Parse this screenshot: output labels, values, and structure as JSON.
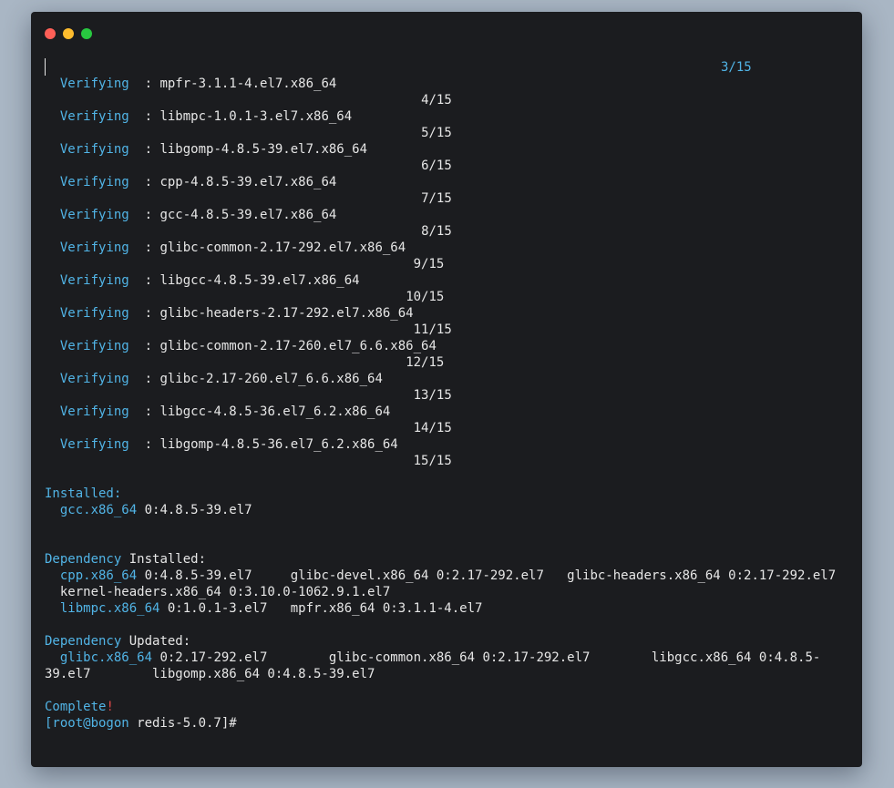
{
  "window": {
    "controls": {
      "close": "close",
      "minimize": "minimize",
      "maximize": "maximize"
    }
  },
  "terminal": {
    "top_counter": "3/15",
    "verify_lines": [
      {
        "label": "Verifying",
        "pkg": "mpfr-3.1.1-4.el7.x86_64",
        "count": "4/15"
      },
      {
        "label": "Verifying",
        "pkg": "libmpc-1.0.1-3.el7.x86_64",
        "count": "5/15"
      },
      {
        "label": "Verifying",
        "pkg": "libgomp-4.8.5-39.el7.x86_64",
        "count": "6/15"
      },
      {
        "label": "Verifying",
        "pkg": "cpp-4.8.5-39.el7.x86_64",
        "count": "7/15"
      },
      {
        "label": "Verifying",
        "pkg": "gcc-4.8.5-39.el7.x86_64",
        "count": "8/15"
      },
      {
        "label": "Verifying",
        "pkg": "glibc-common-2.17-292.el7.x86_64",
        "count": "9/15"
      },
      {
        "label": "Verifying",
        "pkg": "libgcc-4.8.5-39.el7.x86_64",
        "count": "10/15"
      },
      {
        "label": "Verifying",
        "pkg": "glibc-headers-2.17-292.el7.x86_64",
        "count": "11/15"
      },
      {
        "label": "Verifying",
        "pkg": "glibc-common-2.17-260.el7_6.6.x86_64",
        "count": "12/15"
      },
      {
        "label": "Verifying",
        "pkg": "glibc-2.17-260.el7_6.6.x86_64",
        "count": "13/15"
      },
      {
        "label": "Verifying",
        "pkg": "libgcc-4.8.5-36.el7_6.2.x86_64",
        "count": "14/15"
      },
      {
        "label": "Verifying",
        "pkg": "libgomp-4.8.5-36.el7_6.2.x86_64",
        "count": "15/15"
      }
    ],
    "installed": {
      "header": "Installed:",
      "pkg": "gcc.x86_64",
      "ver": " 0:4.8.5-39.el7"
    },
    "dep_installed": {
      "header_kw": "Dependency",
      "header_rest": " Installed:",
      "line1_pkg": "cpp.x86_64",
      "line1_rest": " 0:4.8.5-39.el7     glibc-devel.x86_64 0:2.17-292.el7   glibc-headers.x86_64 0:2.17-292.el7",
      "line2": "  kernel-headers.x86_64 0:3.10.0-1062.9.1.el7",
      "line3_pkg": "libmpc.x86_64",
      "line3_rest": " 0:1.0.1-3.el7   mpfr.x86_64 0:3.1.1-4.el7"
    },
    "dep_updated": {
      "header_kw": "Dependency",
      "header_rest": " Updated:",
      "line1_pkg": "glibc.x86_64",
      "line1_rest": " 0:2.17-292.el7        glibc-common.x86_64 0:2.17-292.el7        libgcc.x86_64 0:4.8.5-",
      "line2": "39.el7        libgomp.x86_64 0:4.8.5-39.el7"
    },
    "complete": {
      "word": "Complete",
      "bang": "!"
    },
    "prompt": {
      "bracket": "[root@bogon",
      "rest": " redis-5.0.7]#"
    }
  },
  "colors": {
    "background": "#1b1c1f",
    "accent": "#51b4e6",
    "text": "#e6e6e6",
    "error": "#e04848",
    "page": "#a9b6c4"
  }
}
